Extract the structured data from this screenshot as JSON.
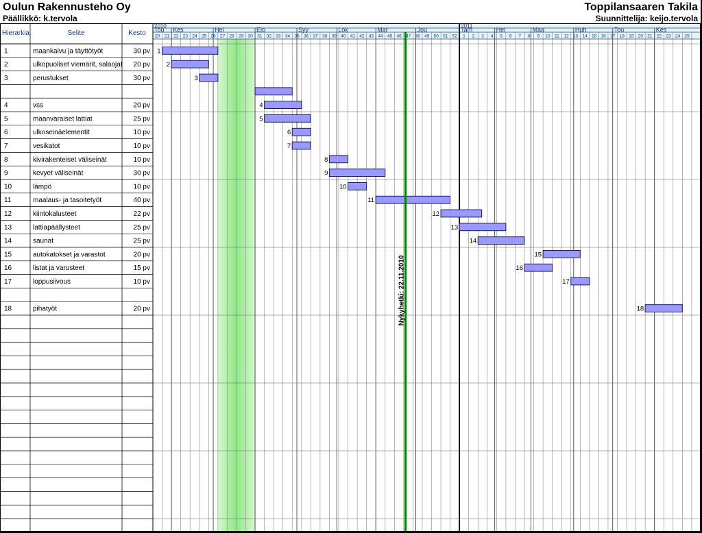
{
  "header": {
    "company": "Oulun Rakennusteho Oy",
    "manager": "Päällikkö: k.tervola",
    "project": "Toppilansaaren Takila",
    "designer": "Suunnittelija: keijo.tervola"
  },
  "columns": {
    "hierarchy": "Hierarkia",
    "description": "Selite",
    "duration": "Kesto"
  },
  "colors": {
    "bar_fill": "#9999ff",
    "bar_stroke": "#1a1a66",
    "header_band": "#e0f4fc",
    "header_text": "#1a3b8a",
    "today_line": "#008000",
    "holiday": "#a8ee9c",
    "grid": "#888888"
  },
  "chart_data": {
    "type": "gantt",
    "time_unit": "week",
    "years": [
      {
        "label": "2010",
        "start_index": 0
      },
      {
        "label": "2011",
        "start_index": 33
      }
    ],
    "weeks": [
      "20",
      "21",
      "22",
      "23",
      "24",
      "25",
      "26",
      "27",
      "28",
      "29",
      "30",
      "31",
      "32",
      "33",
      "34",
      "35",
      "36",
      "37",
      "38",
      "39",
      "40",
      "41",
      "42",
      "43",
      "44",
      "45",
      "46",
      "47",
      "48",
      "49",
      "50",
      "51",
      "52",
      "1",
      "2",
      "3",
      "4",
      "5",
      "6",
      "7",
      "8",
      "9",
      "10",
      "11",
      "12",
      "13",
      "14",
      "15",
      "16",
      "17",
      "18",
      "19",
      "20",
      "21",
      "22",
      "23",
      "24",
      "25"
    ],
    "months": [
      {
        "label": "Tou",
        "start": 0
      },
      {
        "label": "Kes",
        "start": 2
      },
      {
        "label": "Hei",
        "start": 6.5
      },
      {
        "label": "Elo",
        "start": 11
      },
      {
        "label": "Syy",
        "start": 15.5
      },
      {
        "label": "Lok",
        "start": 19.8
      },
      {
        "label": "Mar",
        "start": 24
      },
      {
        "label": "Jou",
        "start": 28.3
      },
      {
        "label": "Tam",
        "start": 33
      },
      {
        "label": "Hel",
        "start": 36.8
      },
      {
        "label": "Maa",
        "start": 40.7
      },
      {
        "label": "Huh",
        "start": 45.3
      },
      {
        "label": "Tou",
        "start": 49.5
      },
      {
        "label": "Kes",
        "start": 54
      }
    ],
    "holiday_weeks": {
      "start": 7,
      "end": 11
    },
    "today": {
      "label": "Nykyhetki: 22.11.2010",
      "week_index": 27.2
    },
    "tasks": [
      {
        "hierarchy": "1",
        "name": "maankaivu ja täyttötyöt",
        "duration": "30 pv",
        "start": 1,
        "end": 7
      },
      {
        "hierarchy": "2",
        "name": "ulkopuoliset viemärit, salaojat",
        "duration": "20 pv",
        "start": 2,
        "end": 6
      },
      {
        "hierarchy": "3",
        "name": "perustukset",
        "duration": "30 pv",
        "start": 5,
        "end": 7
      },
      {
        "hierarchy": "",
        "name": "",
        "duration": "",
        "start": 11,
        "end": 15
      },
      {
        "hierarchy": "4",
        "name": "vss",
        "duration": "20 pv",
        "start": 12,
        "end": 16
      },
      {
        "hierarchy": "5",
        "name": "maanvaraiset lattiat",
        "duration": "25 pv",
        "start": 12,
        "end": 17
      },
      {
        "hierarchy": "6",
        "name": "ulkoseinäelementit",
        "duration": "10 pv",
        "start": 15,
        "end": 17
      },
      {
        "hierarchy": "7",
        "name": "vesikatot",
        "duration": "10 pv",
        "start": 15,
        "end": 17
      },
      {
        "hierarchy": "8",
        "name": "kivirakenteiset väliseinät",
        "duration": "10 pv",
        "start": 19,
        "end": 21
      },
      {
        "hierarchy": "9",
        "name": "kevyet väliseinät",
        "duration": "30 pv",
        "start": 19,
        "end": 25
      },
      {
        "hierarchy": "10",
        "name": "lämpö",
        "duration": "10 pv",
        "start": 21,
        "end": 23
      },
      {
        "hierarchy": "11",
        "name": "maalaus- ja tasoitetyöt",
        "duration": "40 pv",
        "start": 24,
        "end": 32
      },
      {
        "hierarchy": "12",
        "name": "kiintokalusteet",
        "duration": "22 pv",
        "start": 31,
        "end": 35.4
      },
      {
        "hierarchy": "13",
        "name": "lattiapäällysteet",
        "duration": "25 pv",
        "start": 33,
        "end": 38
      },
      {
        "hierarchy": "14",
        "name": "saunat",
        "duration": "25 pv",
        "start": 35,
        "end": 40
      },
      {
        "hierarchy": "15",
        "name": "autokatokset ja varastot",
        "duration": "20 pv",
        "start": 42,
        "end": 46
      },
      {
        "hierarchy": "16",
        "name": "listat ja varusteet",
        "duration": "15 pv",
        "start": 40,
        "end": 43
      },
      {
        "hierarchy": "17",
        "name": "loppusiivous",
        "duration": "10 pv",
        "start": 45,
        "end": 47
      },
      {
        "hierarchy": "",
        "name": "",
        "duration": "",
        "start": null,
        "end": null
      },
      {
        "hierarchy": "18",
        "name": "pihatyöt",
        "duration": "20 pv",
        "start": 53,
        "end": 57
      }
    ]
  }
}
